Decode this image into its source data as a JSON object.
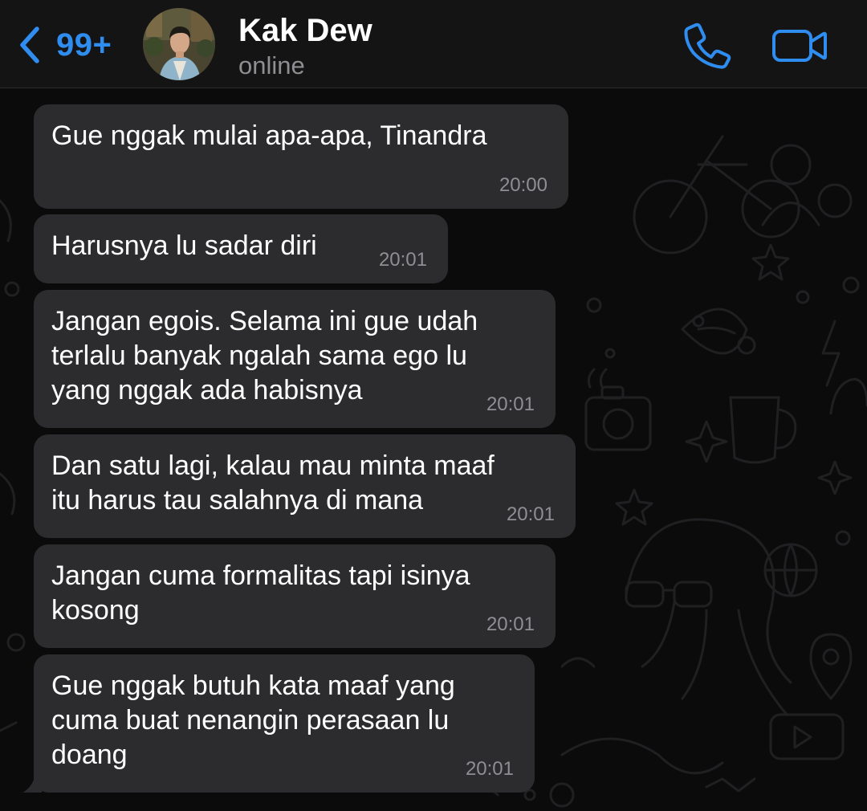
{
  "header": {
    "back_count": "99+",
    "contact_name": "Kak Dew",
    "status": "online"
  },
  "icons": {
    "back": "chevron-left-icon",
    "call": "phone-icon",
    "video": "video-camera-icon"
  },
  "colors": {
    "accent": "#2f8df0",
    "header_bg": "#141414",
    "bubble_bg": "#2c2c2e",
    "chat_bg": "#0b0b0c",
    "timestamp": "#8e8e93"
  },
  "messages": [
    {
      "lines": [
        "Gue nggak mulai apa-apa, Tinandra"
      ],
      "time": "20:00"
    },
    {
      "lines": [
        "Harusnya lu sadar diri"
      ],
      "time": "20:01"
    },
    {
      "lines": [
        "Jangan egois. Selama ini gue udah",
        "terlalu banyak ngalah sama ego lu",
        "yang nggak ada habisnya"
      ],
      "time": "20:01"
    },
    {
      "lines": [
        "Dan satu lagi, kalau mau minta maaf",
        "itu harus tau salahnya di mana"
      ],
      "time": "20:01"
    },
    {
      "lines": [
        "Jangan cuma formalitas tapi isinya",
        "kosong"
      ],
      "time": "20:01"
    },
    {
      "lines": [
        "Gue nggak butuh kata maaf yang",
        "cuma buat nenangin perasaan lu",
        "doang"
      ],
      "time": "20:01"
    }
  ]
}
